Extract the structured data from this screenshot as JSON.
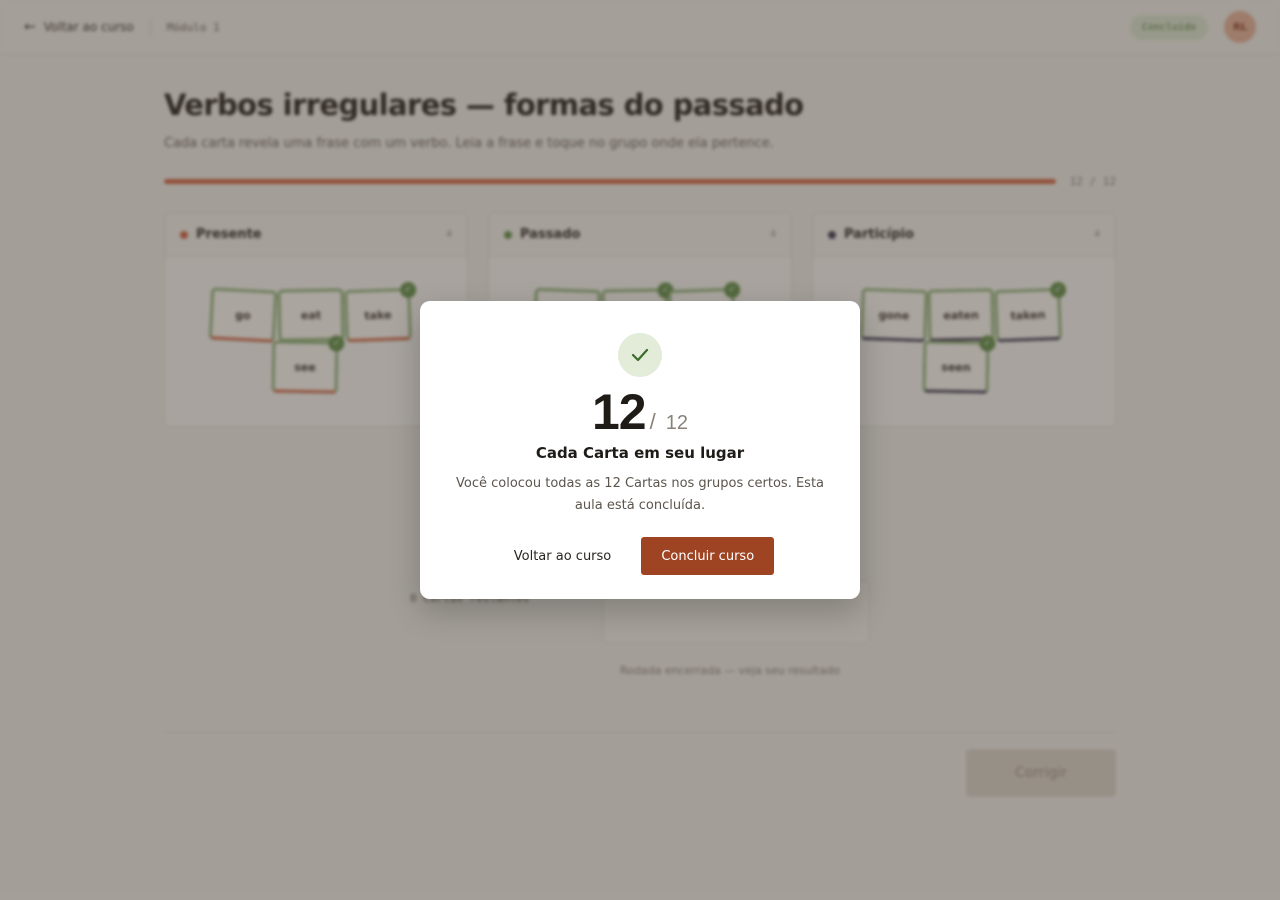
{
  "topbar": {
    "back_label": "Voltar ao curso",
    "module_label": "Módulo 1",
    "status_badge": "Concluído",
    "avatar_initials": "RL"
  },
  "lesson": {
    "title": "Verbos irregulares — formas do passado",
    "subtitle": "Cada carta revela uma frase com um verbo. Leia a frase e toque no grupo onde ela pertence.",
    "progress": {
      "current": 12,
      "total": 12,
      "label": "12 / 12"
    }
  },
  "groups": [
    {
      "name": "Presente",
      "count": "4",
      "color": "#d2603f",
      "cards": [
        "go",
        "eat",
        "take",
        "see"
      ]
    },
    {
      "name": "Passado",
      "count": "4",
      "color": "#5f8f47",
      "cards": [
        "",
        "",
        "",
        ""
      ]
    },
    {
      "name": "Particípio",
      "count": "4",
      "color": "#3a3550",
      "cards": [
        "gone",
        "eaten",
        "taken",
        "seen"
      ]
    }
  ],
  "below": {
    "remaining": "0 Cartas restantes",
    "round_message": "Rodada encerrada — veja seu resultado",
    "check_button": "Corrigir"
  },
  "modal": {
    "score": "12",
    "total": "12",
    "heading": "Cada Carta em seu lugar",
    "text": "Você colocou todas as 12 Cartas nos grupos certos. Esta aula está concluída.",
    "secondary_button": "Voltar ao curso",
    "primary_button": "Concluir curso"
  },
  "colors": {
    "accent": "#9f4423",
    "progress": "#d2603f",
    "success": "#5f8f47"
  }
}
